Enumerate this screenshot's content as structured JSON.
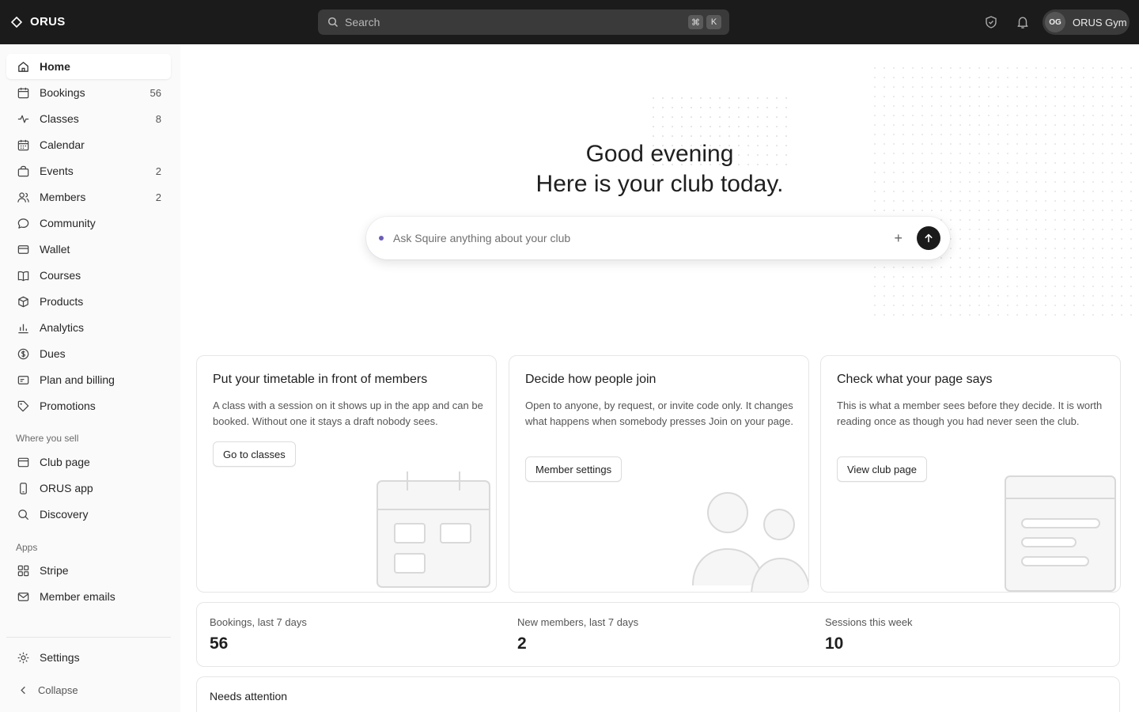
{
  "app": {
    "name": "ORUS"
  },
  "search": {
    "placeholder": "Search",
    "shortcut": [
      "⌘",
      "K"
    ]
  },
  "account": {
    "initials": "OG",
    "name": "ORUS Gym"
  },
  "sidebar": {
    "items": [
      {
        "label": "Home",
        "icon": "home-icon",
        "count": ""
      },
      {
        "label": "Bookings",
        "icon": "calendar-icon",
        "count": "56"
      },
      {
        "label": "Classes",
        "icon": "activity-icon",
        "count": "8"
      },
      {
        "label": "Calendar",
        "icon": "calendar-grid-icon",
        "count": ""
      },
      {
        "label": "Events",
        "icon": "bag-icon",
        "count": "2"
      },
      {
        "label": "Members",
        "icon": "users-icon",
        "count": "2"
      },
      {
        "label": "Community",
        "icon": "chat-icon",
        "count": ""
      },
      {
        "label": "Wallet",
        "icon": "card-icon",
        "count": ""
      },
      {
        "label": "Courses",
        "icon": "book-icon",
        "count": ""
      },
      {
        "label": "Products",
        "icon": "box-icon",
        "count": ""
      },
      {
        "label": "Analytics",
        "icon": "bar-chart-icon",
        "count": ""
      },
      {
        "label": "Dues",
        "icon": "dollar-icon",
        "count": ""
      },
      {
        "label": "Plan and billing",
        "icon": "billing-icon",
        "count": ""
      },
      {
        "label": "Promotions",
        "icon": "tag-icon",
        "count": ""
      }
    ],
    "sell_label": "Where you sell",
    "sell_items": [
      {
        "label": "Club page",
        "icon": "browser-icon"
      },
      {
        "label": "ORUS app",
        "icon": "phone-icon"
      },
      {
        "label": "Discovery",
        "icon": "search-icon"
      }
    ],
    "apps_label": "Apps",
    "apps_items": [
      {
        "label": "Stripe",
        "icon": "grid-icon"
      },
      {
        "label": "Member emails",
        "icon": "mail-icon"
      }
    ],
    "settings_label": "Settings",
    "collapse_label": "Collapse"
  },
  "hero": {
    "line1": "Good evening",
    "line2": "Here is your club today.",
    "ask_placeholder": "Ask Squire anything about your club"
  },
  "cards": [
    {
      "title": "Put your timetable in front of members",
      "desc": "A class with a session on it shows up in the app and can be booked. Without one it stays a draft nobody sees.",
      "button": "Go to classes"
    },
    {
      "title": "Decide how people join",
      "desc": "Open to anyone, by request, or invite code only. It changes what happens when somebody presses Join on your page.",
      "button": "Member settings"
    },
    {
      "title": "Check what your page says",
      "desc": "This is what a member sees before they decide. It is worth reading once as though you had never seen the club.",
      "button": "View club page"
    }
  ],
  "stats": [
    {
      "label": "Bookings, last 7 days",
      "value": "56"
    },
    {
      "label": "New members, last 7 days",
      "value": "2"
    },
    {
      "label": "Sessions this week",
      "value": "10"
    }
  ],
  "attention": {
    "title": "Needs attention"
  }
}
